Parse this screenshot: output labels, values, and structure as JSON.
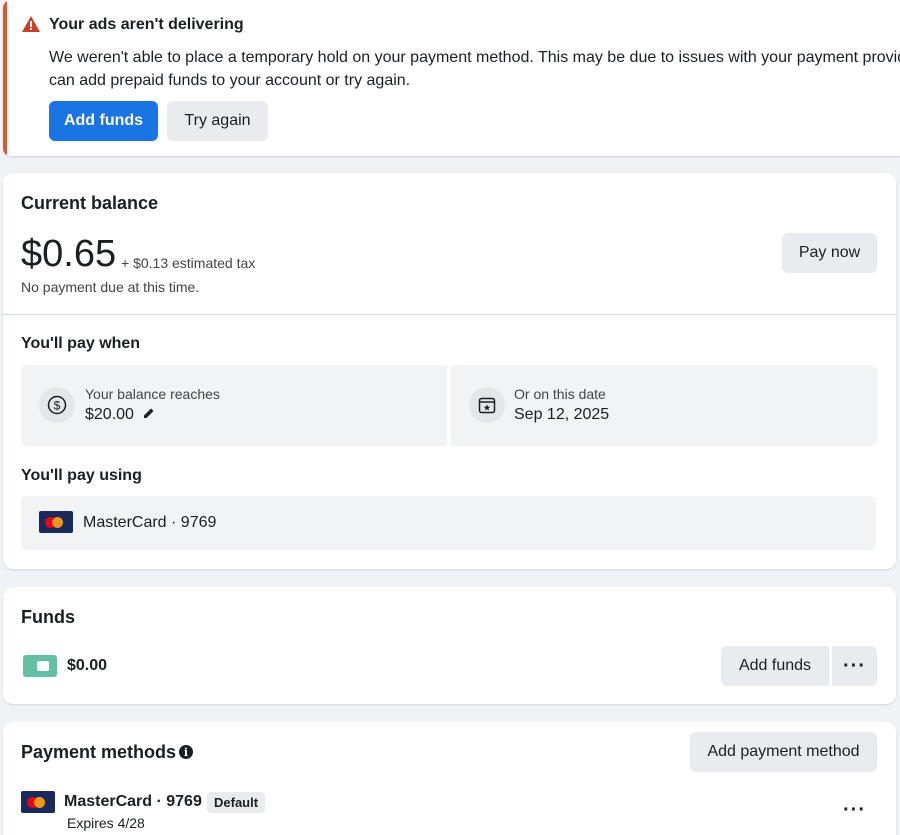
{
  "alert": {
    "title": "Your ads aren't delivering",
    "message_line1": "We weren't able to place a temporary hold on your payment method. This may be due to issues with your payment provider. You",
    "message_line2": "can add prepaid funds to your account or try again.",
    "add_funds_label": "Add funds",
    "try_again_label": "Try again",
    "accent_color": "#e0532c"
  },
  "balance": {
    "title": "Current balance",
    "amount": "$0.65",
    "tax": "+ $0.13 estimated tax",
    "due_note": "No payment due at this time.",
    "pay_now_label": "Pay now",
    "pay_when_title": "You'll pay when",
    "threshold_label": "Your balance reaches",
    "threshold_value": "$20.00",
    "date_label": "Or on this date",
    "date_value": "Sep 12, 2025",
    "pay_using_title": "You'll pay using",
    "card_text": "MasterCard · 9769"
  },
  "funds": {
    "title": "Funds",
    "amount": "$0.00",
    "add_funds_label": "Add funds",
    "more_label": "···"
  },
  "payment_methods": {
    "title": "Payment methods",
    "add_label": "Add payment method",
    "card_name": "MasterCard · 9769",
    "default_badge": "Default",
    "expires": "Expires 4/28",
    "more_label": "···"
  },
  "colors": {
    "primary": "#1b74e4",
    "wallet": "#63bfa6"
  }
}
